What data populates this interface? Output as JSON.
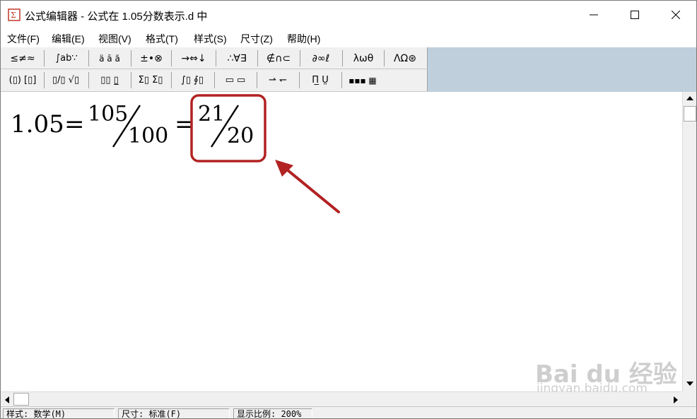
{
  "window": {
    "title": "公式编辑器 - 公式在 1.05分数表示.d 中",
    "min_icon": "minimize-icon",
    "max_icon": "maximize-icon",
    "close_icon": "close-icon"
  },
  "menu": [
    "文件(F)",
    "编辑(E)",
    "视图(V)",
    "格式(T)",
    "样式(S)",
    "尺寸(Z)",
    "帮助(H)"
  ],
  "toolbar": {
    "row1": [
      {
        "label": "≤≠≈",
        "name": "relational-symbols-button"
      },
      {
        "label": "∫ab∵",
        "name": "spaces-ellipses-button"
      },
      {
        "label": "ä ā ã",
        "name": "embellishments-button"
      },
      {
        "label": "±•⊗",
        "name": "operator-symbols-button"
      },
      {
        "label": "→⇔↓",
        "name": "arrow-symbols-button"
      },
      {
        "label": "∴∀∃",
        "name": "logical-symbols-button"
      },
      {
        "label": "∉∩⊂",
        "name": "set-theory-symbols-button"
      },
      {
        "label": "∂∞ℓ",
        "name": "misc-symbols-button"
      },
      {
        "label": "λωθ",
        "name": "greek-lowercase-button"
      },
      {
        "label": "ΛΩ⊛",
        "name": "greek-uppercase-button"
      }
    ],
    "row2": [
      {
        "label": "(▯) [▯]",
        "name": "fence-templates-button"
      },
      {
        "label": "▯/▯ √▯",
        "name": "fraction-radical-templates-button"
      },
      {
        "label": "▯▯ ▯̲",
        "name": "subscript-superscript-templates-button"
      },
      {
        "label": "Σ▯ Σ▯",
        "name": "summation-templates-button"
      },
      {
        "label": "∫▯ ∮▯",
        "name": "integral-templates-button"
      },
      {
        "label": "▭ ▭",
        "name": "underbar-overbar-templates-button"
      },
      {
        "label": "⇀ ↽",
        "name": "labeled-arrow-templates-button"
      },
      {
        "label": "Π̲ Ṳ",
        "name": "products-set-templates-button"
      },
      {
        "label": "▪▪▪ ▦",
        "name": "matrix-templates-button"
      }
    ]
  },
  "equation": {
    "lhs": "1.05",
    "eq": "=",
    "frac1_num": "105",
    "frac1_den": "100",
    "frac2_num": "21",
    "frac2_den": "20",
    "highlight_color": "#b22222"
  },
  "status": {
    "style": "样式: 数学(M)",
    "size": "尺寸: 标准(F)",
    "zoom": "显示比例: 200%"
  },
  "watermark": {
    "brand": "Bai du 经验",
    "url": "jingyan.baidu.com"
  }
}
